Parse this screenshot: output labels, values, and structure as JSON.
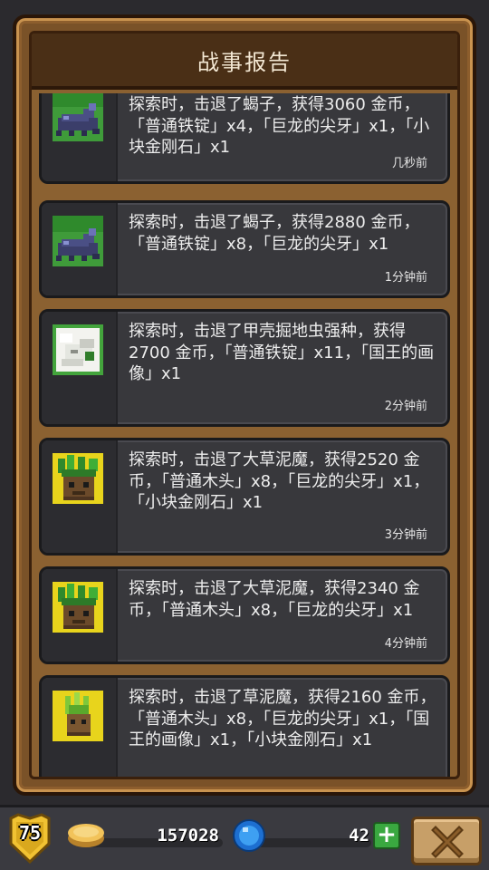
{
  "panel": {
    "title": "战事报告"
  },
  "reports": [
    {
      "message": "探索时，击退了蝎子，获得3060 金币，「普通铁锭」x4，「巨龙的尖牙」x1，「小块金刚石」x1",
      "time": "几秒前",
      "monster_icon": "scorpion-icon"
    },
    {
      "message": "探索时，击退了蝎子，获得2880 金币，「普通铁锭」x8，「巨龙的尖牙」x1",
      "time": "1分钟前",
      "monster_icon": "scorpion-icon"
    },
    {
      "message": "探索时，击退了甲壳掘地虫强种，获得2700 金币，「普通铁锭」x11，「国王的画像」x1",
      "time": "2分钟前",
      "monster_icon": "shell-burrower-icon"
    },
    {
      "message": "探索时，击退了大草泥魔，获得2520 金币，「普通木头」x8，「巨龙的尖牙」x1，「小块金刚石」x1",
      "time": "3分钟前",
      "monster_icon": "big-grass-mud-golem-icon"
    },
    {
      "message": "探索时，击退了大草泥魔，获得2340 金币，「普通木头」x8，「巨龙的尖牙」x1",
      "time": "4分钟前",
      "monster_icon": "big-grass-mud-golem-icon"
    },
    {
      "message": "探索时，击退了草泥魔，获得2160 金币，「普通木头」x8，「巨龙的尖牙」x1，「国王的画像」x1，「小块金刚石」x1",
      "time": "",
      "monster_icon": "grass-mud-golem-icon"
    }
  ],
  "status_bar": {
    "level": "75",
    "coins": "157028",
    "gems": "42",
    "icons": [
      "level-shield-icon",
      "gold-coin-icon",
      "blue-gem-icon",
      "plus-icon",
      "close-x-icon"
    ]
  },
  "colors": {
    "panel_wood": "#7a5228",
    "title_bar": "#4a2f16",
    "card_bg": "#38383c",
    "text": "#ededed",
    "plus_green": "#3aa840",
    "close_button": "#c79f68"
  }
}
